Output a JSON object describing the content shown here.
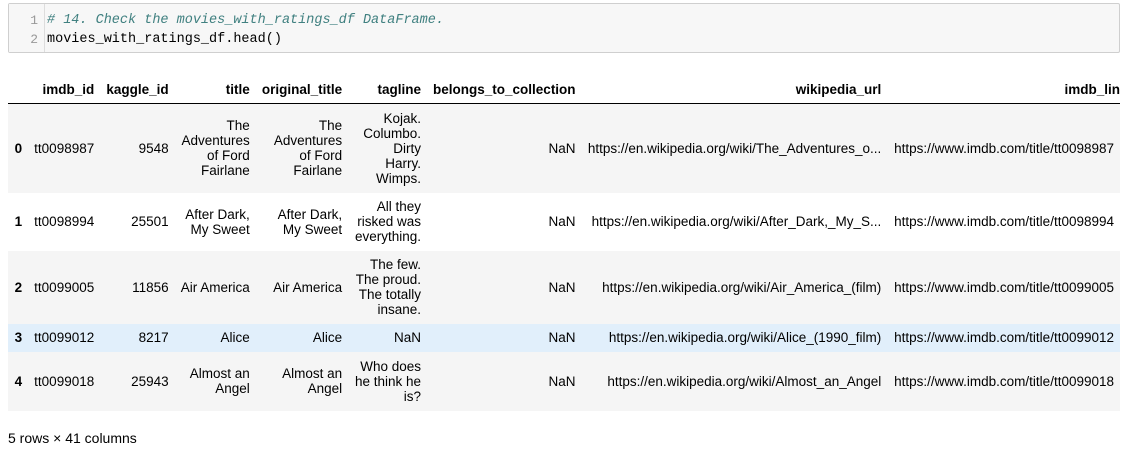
{
  "code": {
    "line_numbers": [
      "1",
      "2"
    ],
    "comment": "# 14. Check the movies_with_ratings_df DataFrame.",
    "statement": "movies_with_ratings_df.head()"
  },
  "table": {
    "columns": [
      "",
      "imdb_id",
      "kaggle_id",
      "title",
      "original_title",
      "tagline",
      "belongs_to_collection",
      "wikipedia_url",
      "imdb_lin"
    ],
    "rows": [
      {
        "index": "0",
        "imdb_id": "tt0098987",
        "kaggle_id": "9548",
        "title": "The Adventures of Ford Fairlane",
        "original_title": "The Adventures of Ford Fairlane",
        "tagline": "Kojak. Columbo. Dirty Harry. Wimps.",
        "belongs_to_collection": "NaN",
        "wikipedia_url": "https://en.wikipedia.org/wiki/The_Adventures_o...",
        "imdb_link": "https://www.imdb.com/title/tt0098987"
      },
      {
        "index": "1",
        "imdb_id": "tt0098994",
        "kaggle_id": "25501",
        "title": "After Dark, My Sweet",
        "original_title": "After Dark, My Sweet",
        "tagline": "All they risked was everything.",
        "belongs_to_collection": "NaN",
        "wikipedia_url": "https://en.wikipedia.org/wiki/After_Dark,_My_S...",
        "imdb_link": "https://www.imdb.com/title/tt0098994"
      },
      {
        "index": "2",
        "imdb_id": "tt0099005",
        "kaggle_id": "11856",
        "title": "Air America",
        "original_title": "Air America",
        "tagline": "The few. The proud. The totally insane.",
        "belongs_to_collection": "NaN",
        "wikipedia_url": "https://en.wikipedia.org/wiki/Air_America_(film)",
        "imdb_link": "https://www.imdb.com/title/tt0099005"
      },
      {
        "index": "3",
        "imdb_id": "tt0099012",
        "kaggle_id": "8217",
        "title": "Alice",
        "original_title": "Alice",
        "tagline": "NaN",
        "belongs_to_collection": "NaN",
        "wikipedia_url": "https://en.wikipedia.org/wiki/Alice_(1990_film)",
        "imdb_link": "https://www.imdb.com/title/tt0099012"
      },
      {
        "index": "4",
        "imdb_id": "tt0099018",
        "kaggle_id": "25943",
        "title": "Almost an Angel",
        "original_title": "Almost an Angel",
        "tagline": "Who does he think he is?",
        "belongs_to_collection": "NaN",
        "wikipedia_url": "https://en.wikipedia.org/wiki/Almost_an_Angel",
        "imdb_link": "https://www.imdb.com/title/tt0099018"
      }
    ]
  },
  "footer": "5 rows × 41 columns"
}
